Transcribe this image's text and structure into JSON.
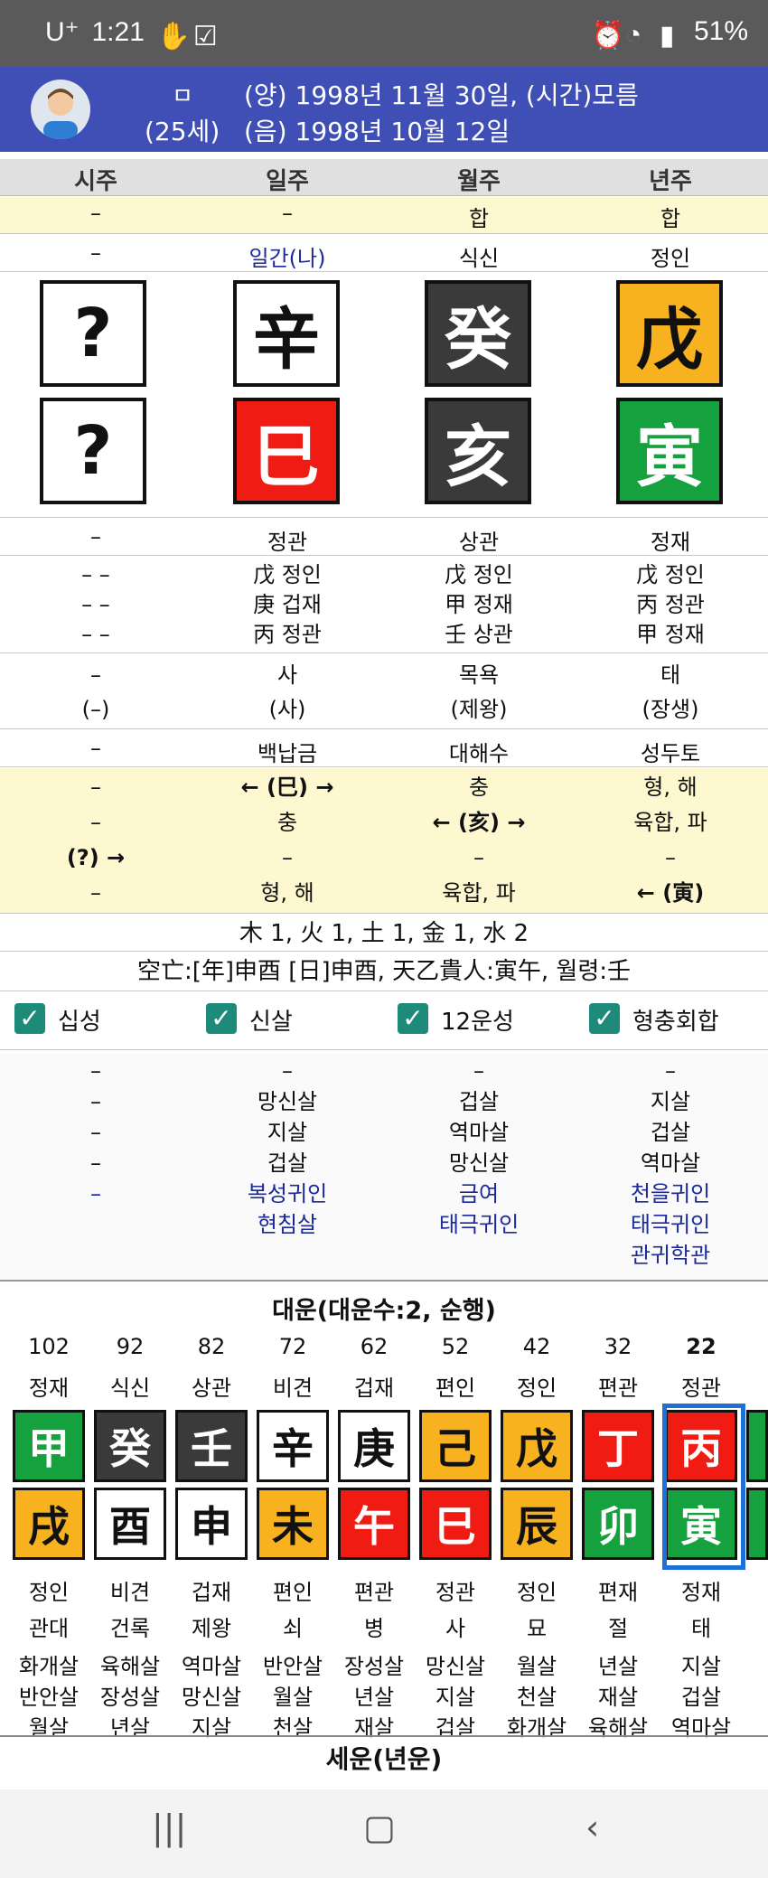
{
  "status": {
    "carrier": "U⁺",
    "time": "1:21",
    "battery": "51%"
  },
  "profile": {
    "name": "ㅁ",
    "age": "(25세)",
    "solar": "(양) 1998년 11월 30일, (시간)모름",
    "lunar": "(음) 1998년 10월 12일"
  },
  "columns": [
    "시주",
    "일주",
    "월주",
    "년주"
  ],
  "row_hap": [
    "–",
    "–",
    "합",
    "합"
  ],
  "row_top_ten": [
    "–",
    "일간(나)",
    "식신",
    "정인"
  ],
  "stems": [
    {
      "char": "?",
      "color": "white"
    },
    {
      "char": "辛",
      "color": "white"
    },
    {
      "char": "癸",
      "color": "black"
    },
    {
      "char": "戊",
      "color": "yellow"
    }
  ],
  "branches": [
    {
      "char": "?",
      "color": "white"
    },
    {
      "char": "巳",
      "color": "red"
    },
    {
      "char": "亥",
      "color": "black"
    },
    {
      "char": "寅",
      "color": "green"
    }
  ],
  "row_bottom_ten": [
    "–",
    "정관",
    "상관",
    "정재"
  ],
  "hidden": [
    [
      "– –",
      "– –",
      "– –"
    ],
    [
      "戊 정인",
      "庚 겁재",
      "丙 정관"
    ],
    [
      "戊 정인",
      "甲 정재",
      "壬 상관"
    ],
    [
      "戊 정인",
      "丙 정관",
      "甲 정재"
    ]
  ],
  "unseong1": [
    "–",
    "사",
    "목욕",
    "태"
  ],
  "unseong2": [
    "(–)",
    "(사)",
    "(제왕)",
    "(장생)"
  ],
  "napeum": [
    "–",
    "백납금",
    "대해수",
    "성두토"
  ],
  "relations": [
    [
      "–",
      "← (巳) →",
      "충",
      "형, 해"
    ],
    [
      "–",
      "충",
      "← (亥) →",
      "육합, 파"
    ],
    [
      "(?) →",
      "–",
      "–",
      "–"
    ],
    [
      "–",
      "형, 해",
      "육합, 파",
      "← (寅)"
    ]
  ],
  "elements": "木 1, 火 1, 土 1, 金 1, 水 2",
  "gongmang": "空亡:[年]申酉 [日]申酉, 天乙貴人:寅午, 월령:壬",
  "checks": [
    "십성",
    "신살",
    "12운성",
    "형충회합"
  ],
  "sinsal": [
    [
      "–",
      "–",
      "–",
      "–"
    ],
    [
      "–",
      "망신살",
      "겁살",
      "지살"
    ],
    [
      "–",
      "지살",
      "역마살",
      "겁살"
    ],
    [
      "–",
      "겁살",
      "망신살",
      "역마살"
    ]
  ],
  "sinsal_blue": [
    [
      "–",
      "복성귀인",
      "금여",
      "천을귀인"
    ],
    [
      "",
      "현침살",
      "태극귀인",
      "태극귀인"
    ],
    [
      "",
      "",
      "",
      "관귀학관"
    ]
  ],
  "daeun": {
    "title": "대운(대운수:2, 순행)",
    "ages": [
      "102",
      "92",
      "82",
      "72",
      "62",
      "52",
      "42",
      "32",
      "22"
    ],
    "tens_top": [
      "정재",
      "식신",
      "상관",
      "비견",
      "겁재",
      "편인",
      "정인",
      "편관",
      "정관"
    ],
    "stems": [
      {
        "c": "甲",
        "k": "green"
      },
      {
        "c": "癸",
        "k": "black"
      },
      {
        "c": "壬",
        "k": "black"
      },
      {
        "c": "辛",
        "k": "white"
      },
      {
        "c": "庚",
        "k": "white"
      },
      {
        "c": "己",
        "k": "yellow"
      },
      {
        "c": "戊",
        "k": "yellow"
      },
      {
        "c": "丁",
        "k": "red"
      },
      {
        "c": "丙",
        "k": "red"
      }
    ],
    "branches": [
      {
        "c": "戌",
        "k": "yellow"
      },
      {
        "c": "酉",
        "k": "white"
      },
      {
        "c": "申",
        "k": "white"
      },
      {
        "c": "未",
        "k": "yellow"
      },
      {
        "c": "午",
        "k": "red"
      },
      {
        "c": "巳",
        "k": "red"
      },
      {
        "c": "辰",
        "k": "yellow"
      },
      {
        "c": "卯",
        "k": "green"
      },
      {
        "c": "寅",
        "k": "green"
      }
    ],
    "tens_bottom": [
      "정인",
      "비견",
      "겁재",
      "편인",
      "편관",
      "정관",
      "정인",
      "편재",
      "정재"
    ],
    "unseong": [
      "관대",
      "건록",
      "제왕",
      "쇠",
      "병",
      "사",
      "묘",
      "절",
      "태"
    ],
    "sal1": [
      "화개살",
      "육해살",
      "역마살",
      "반안살",
      "장성살",
      "망신살",
      "월살",
      "년살",
      "지살"
    ],
    "sal2": [
      "반안살",
      "장성살",
      "망신살",
      "월살",
      "년살",
      "지살",
      "천살",
      "재살",
      "겁살"
    ],
    "sal3": [
      "월살",
      "년살",
      "지살",
      "천살",
      "재살",
      "겁살",
      "화개살",
      "육해살",
      "역마살"
    ]
  },
  "seun_title": "세운(년운)",
  "colors": {
    "header_blue": "#3f4fb5",
    "yellow_row": "#fef8d0",
    "select": "#1e6fd6"
  }
}
